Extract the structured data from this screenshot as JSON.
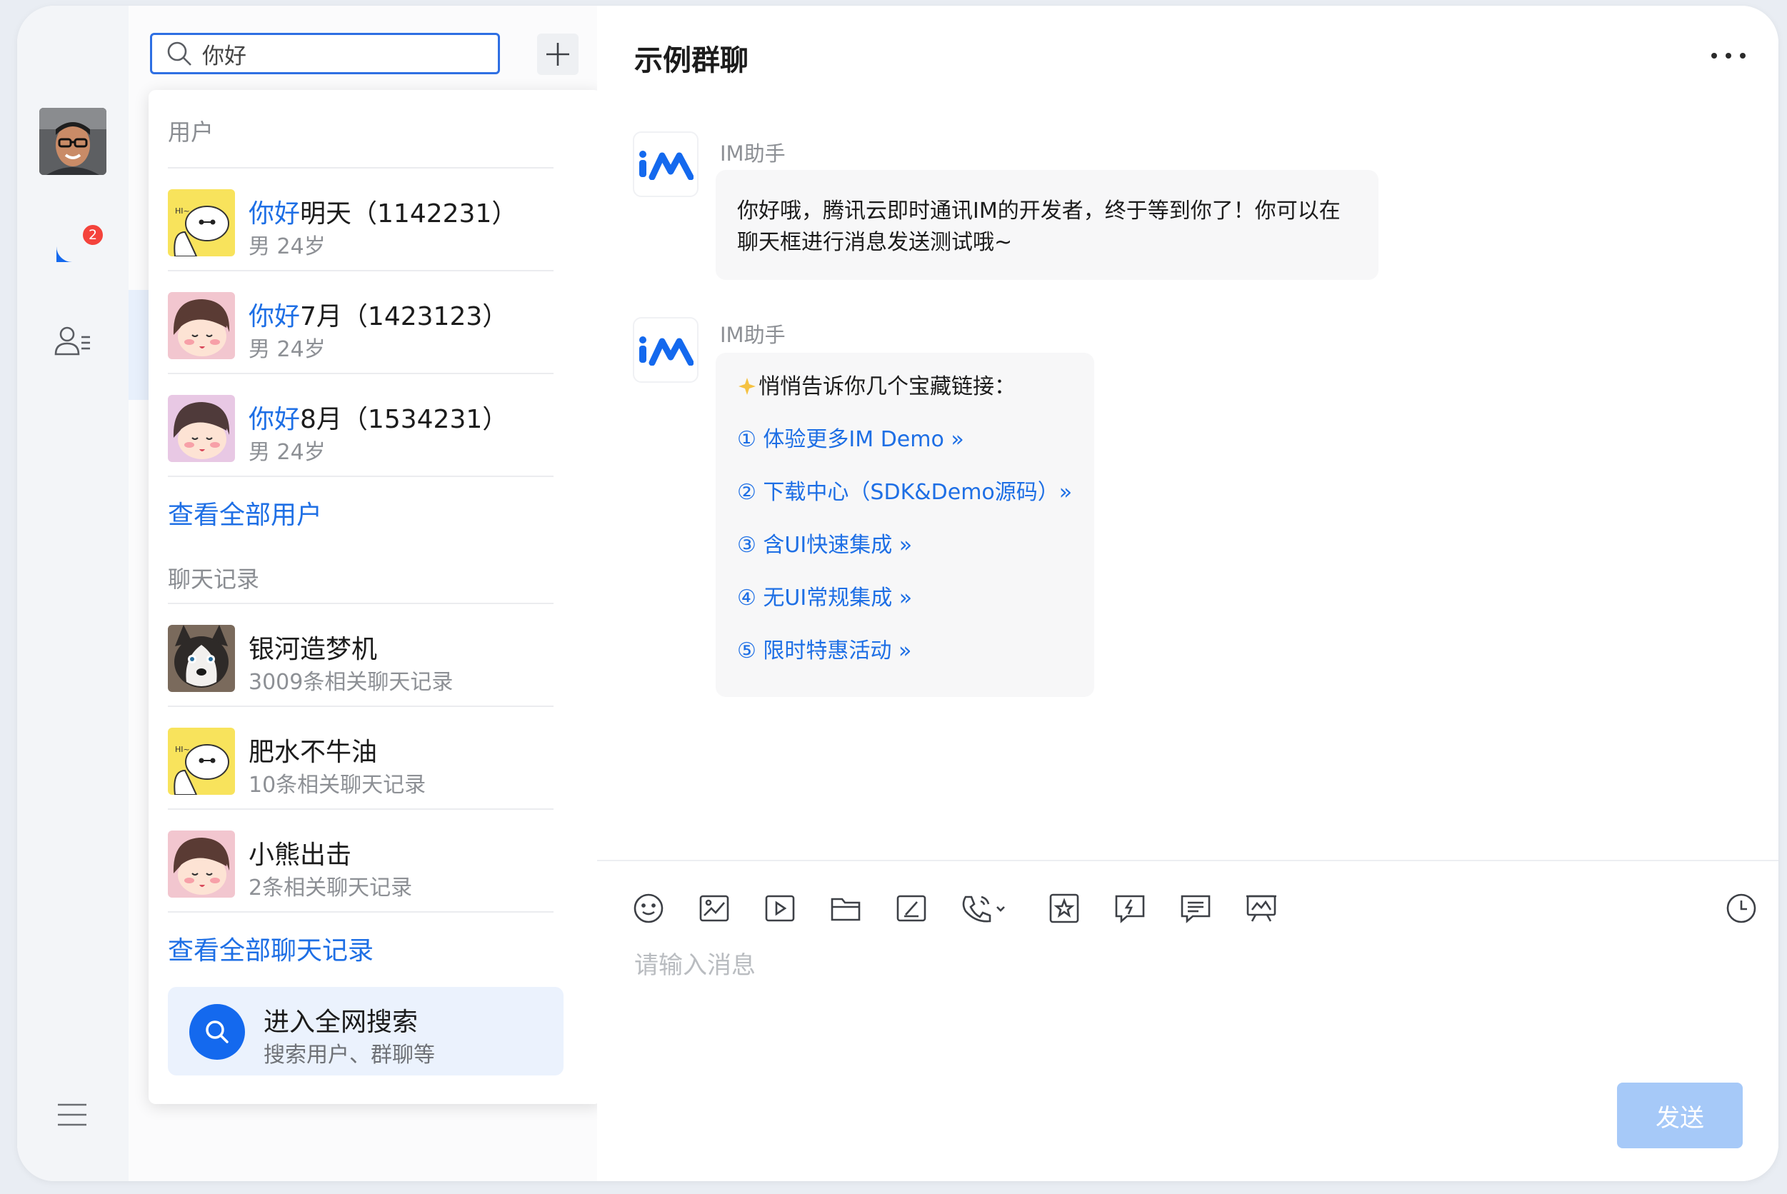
{
  "rail": {
    "unread_count": "2"
  },
  "search": {
    "value": "你好"
  },
  "dropdown": {
    "users_title": "用户",
    "users": [
      {
        "match": "你好",
        "rest": "明天（1142231）",
        "sub": "男  24岁",
        "avatar": "baymax"
      },
      {
        "match": "你好",
        "rest": "7月（1423123）",
        "sub": "男  24岁",
        "avatar": "cartoon-girl"
      },
      {
        "match": "你好",
        "rest": "8月（1534231）",
        "sub": "男  24岁",
        "avatar": "cartoon-girl"
      }
    ],
    "view_all_users": "查看全部用户",
    "records_title": "聊天记录",
    "records": [
      {
        "name": "银河造梦机",
        "sub": "3009条相关聊天记录",
        "avatar": "husky"
      },
      {
        "name": "肥水不牛油",
        "sub": "10条相关聊天记录",
        "avatar": "baymax"
      },
      {
        "name": "小熊出击",
        "sub": "2条相关聊天记录",
        "avatar": "cartoon-girl"
      }
    ],
    "view_all_records": "查看全部聊天记录",
    "global_search": {
      "title": "进入全网搜索",
      "sub": "搜索用户、群聊等"
    }
  },
  "chat": {
    "title": "示例群聊",
    "messages": [
      {
        "sender": "IM助手",
        "lines": [
          "你好哦，腾讯云即时通讯IM的开发者，终于等到你了！你可以在",
          "聊天框进行消息发送测试哦~"
        ]
      },
      {
        "sender": "IM助手",
        "intro": "悄悄告诉你几个宝藏链接：",
        "links": [
          "① 体验更多IM Demo »",
          "② 下载中心（SDK&Demo源码）»",
          "③ 含UI快速集成 »",
          "④ 无UI常规集成 »",
          "⑤ 限时特惠活动 »"
        ]
      }
    ],
    "input_placeholder": "请输入消息",
    "send_label": "发送"
  }
}
